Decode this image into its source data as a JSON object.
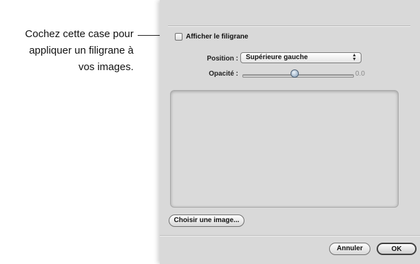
{
  "callout": {
    "lines": [
      "Cochez cette case pour",
      "appliquer un filigrane à",
      "vos images."
    ]
  },
  "watermark": {
    "show_label": "Afficher le filigrane",
    "checked": false
  },
  "position": {
    "label": "Position :",
    "value": "Supérieure gauche"
  },
  "opacity": {
    "label": "Opacité :",
    "value_text": "0.0"
  },
  "buttons": {
    "choose_image": "Choisir une image...",
    "cancel": "Annuler",
    "ok": "OK"
  },
  "icons": {
    "popup_arrows": "up-down-chevron-icon",
    "slider_thumb": "slider-thumb-icon"
  }
}
